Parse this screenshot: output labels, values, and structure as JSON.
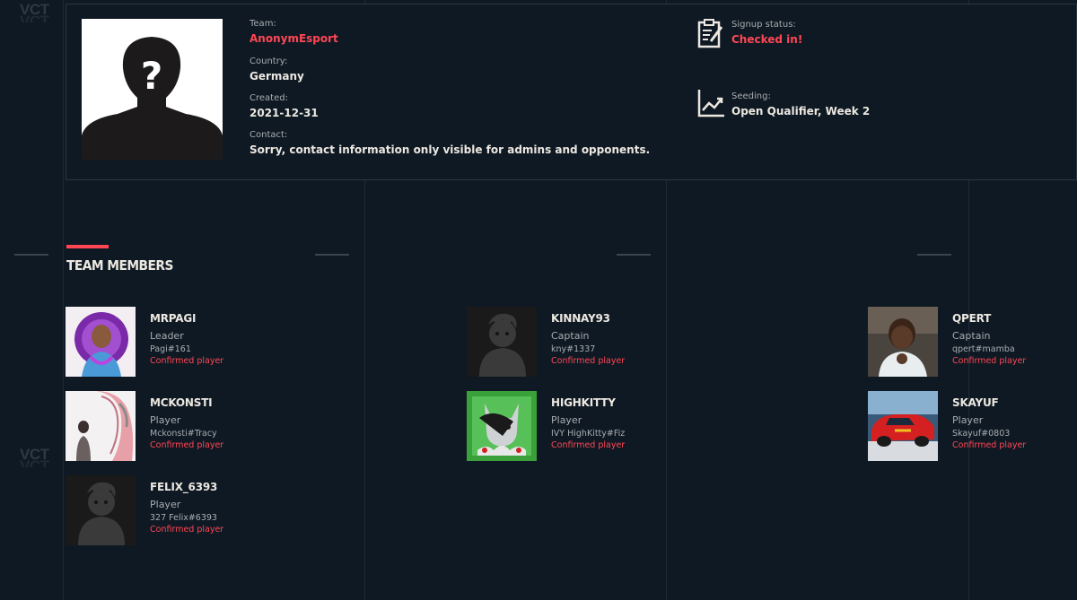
{
  "watermark": {
    "text": "VCT"
  },
  "team_card": {
    "team_label": "Team:",
    "team_name": "AnonymEsport",
    "country_label": "Country:",
    "country": "Germany",
    "created_label": "Created:",
    "created": "2021-12-31",
    "contact_label": "Contact:",
    "contact": "Sorry, contact information only visible for admins and opponents.",
    "signup_label": "Signup status:",
    "signup_value": "Checked in!",
    "seeding_label": "Seeding:",
    "seeding_value": "Open Qualifier, Week 2"
  },
  "section": {
    "title": "TEAM MEMBERS"
  },
  "members": [
    {
      "name": "MRPAGI",
      "role": "Leader",
      "tag": "Pagi#161",
      "status": "Confirmed player",
      "avatar": "purple-character-avatar"
    },
    {
      "name": "KINNAY93",
      "role": "Captain",
      "tag": "kny#1337",
      "status": "Confirmed player",
      "avatar": "default-silhouette-avatar"
    },
    {
      "name": "QPERT",
      "role": "Captain",
      "tag": "qpert#mamba",
      "status": "Confirmed player",
      "avatar": "photo-avatar"
    },
    {
      "name": "MCKONSTI",
      "role": "Player",
      "tag": "Mckonsti#Tracy",
      "status": "Confirmed player",
      "avatar": "anime-sketch-avatar"
    },
    {
      "name": "HIGHKITTY",
      "role": "Player",
      "tag": "IVY HighKitty#Fiz",
      "status": "Confirmed player",
      "avatar": "green-cat-avatar"
    },
    {
      "name": "SKAYUF",
      "role": "Player",
      "tag": "Skayuf#0803",
      "status": "Confirmed player",
      "avatar": "red-car-avatar"
    },
    {
      "name": "FELIX_6393",
      "role": "Player",
      "tag": "327 Felix#6393",
      "status": "Confirmed player",
      "avatar": "default-silhouette-avatar"
    }
  ],
  "colors": {
    "background": "#0f1923",
    "accent": "#ff4655",
    "text": "#ece8e1",
    "muted": "#a7acb1"
  }
}
